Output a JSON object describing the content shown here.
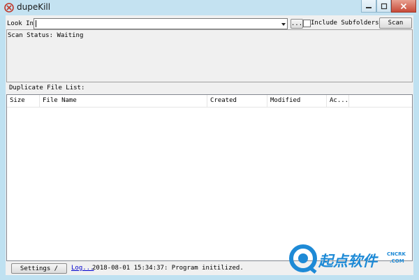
{
  "window": {
    "title": "dupeKill",
    "controls": {
      "minimize_icon": "minimize-icon",
      "maximize_icon": "maximize-icon",
      "close_icon": "close-icon"
    }
  },
  "search": {
    "look_in_label": "Look In:",
    "look_in_value": "",
    "browse_label": "...",
    "include_subfolders_label": "Include Subfolders",
    "include_subfolders_checked": false,
    "scan_label": "Scan"
  },
  "scan_status": {
    "text": "Scan Status: Waiting"
  },
  "duplicates": {
    "title": "Duplicate File List:",
    "columns": [
      "Size",
      "File Name",
      "Created",
      "Modified",
      "Ac..."
    ],
    "rows": []
  },
  "statusbar": {
    "settings_label": "Settings /",
    "log_label": "Log...",
    "message": "2018-08-01 15:34:37: Program initilized."
  },
  "watermark": {
    "text": "起点软件",
    "small_top": "CNCRK",
    "small_bottom": ".COM"
  },
  "colors": {
    "accent": "#1a8fd1",
    "watermark_blue": "#1e8ad6"
  }
}
